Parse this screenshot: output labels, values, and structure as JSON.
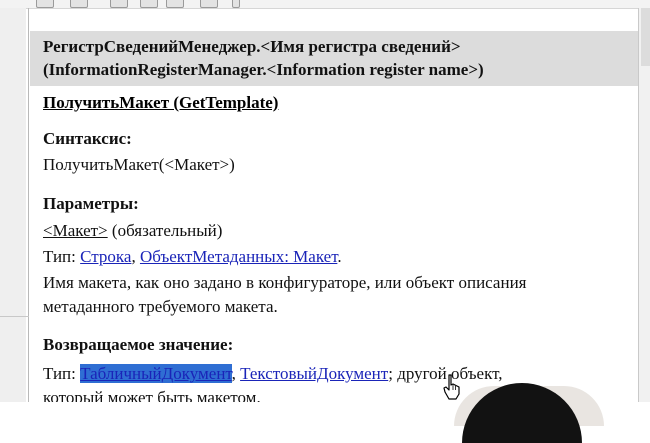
{
  "header": {
    "title_line1": "РегистрСведенийМенеджер.<Имя регистра сведений>",
    "title_line2": "(InformationRegisterManager.<Information register name>)"
  },
  "method": {
    "title": "ПолучитьМакет (GetTemplate)"
  },
  "syntax": {
    "heading": "Синтаксис:",
    "text": "ПолучитьМакет(<Макет>)"
  },
  "parameters": {
    "heading": "Параметры:",
    "param_name": "<Макет>",
    "param_qualifier": " (обязательный)",
    "type_prefix": "Тип: ",
    "type_link1": "Строка",
    "sep": ", ",
    "type_link2": "ОбъектМетаданных: Макет",
    "type_end": ".",
    "desc_line1": "Имя макета, как оно задано в конфигураторе, или объект описания",
    "desc_line2": "метаданного требуемого макета."
  },
  "return_value": {
    "heading": "Возвращаемое значение:",
    "type_prefix": "Тип: ",
    "type_link1": "ТабличныйДокумент",
    "sep": ", ",
    "type_link2": "ТекстовыйДокумент",
    "rest": "; другой объект,",
    "line2": "который может быть макетом."
  }
}
